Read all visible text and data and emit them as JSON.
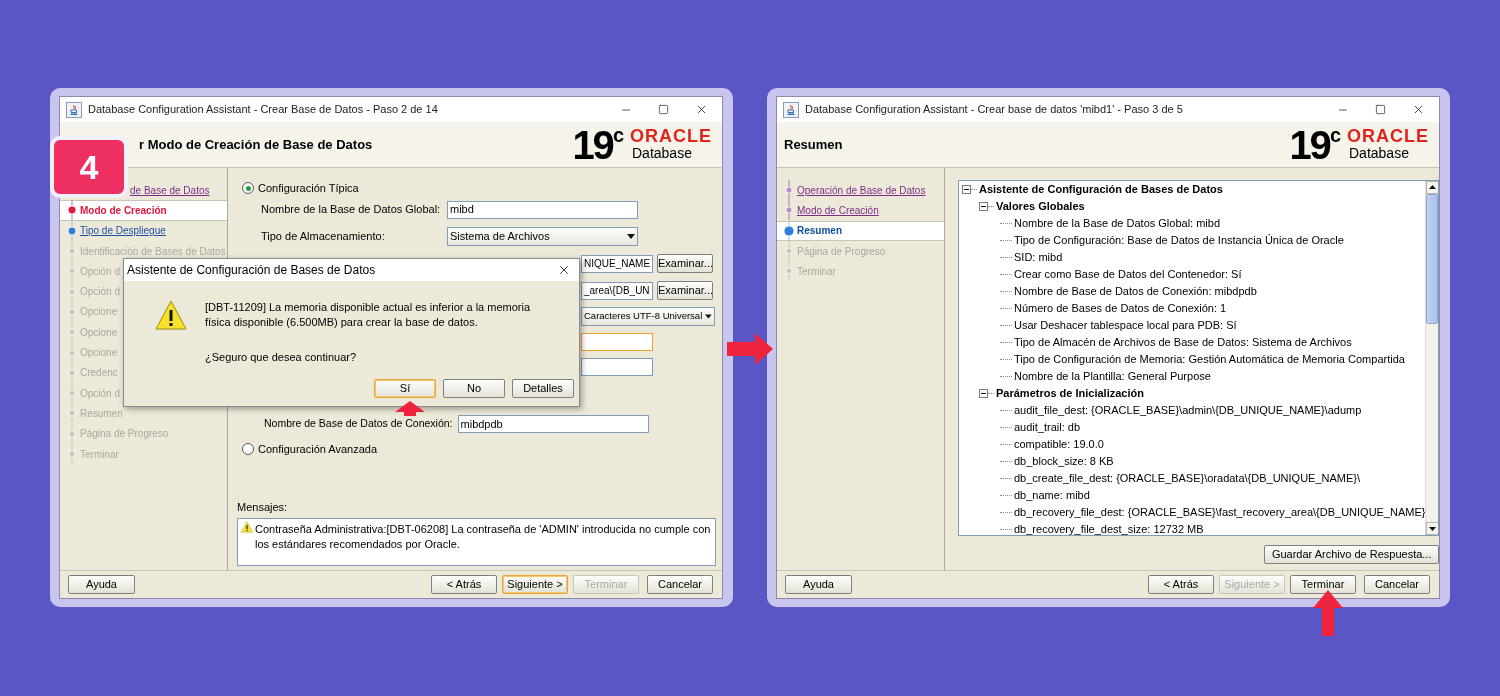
{
  "badge": {
    "label": "4"
  },
  "left_window": {
    "title": "Database Configuration Assistant - Crear Base de Datos - Paso 2 de 14",
    "header_title": "r Modo de Creación de Base de Datos",
    "logo": {
      "version": "19",
      "suffix": "c",
      "brand": "ORACLE",
      "product": "Database"
    },
    "steps": [
      {
        "label": "de Base de Datos",
        "kind": "visited"
      },
      {
        "label": "Modo de Creación",
        "kind": "error"
      },
      {
        "label": "Tipo de Despliegue",
        "kind": "available"
      },
      {
        "label": "Identificación de Bases de Datos",
        "kind": "pending"
      },
      {
        "label": "Opción d",
        "kind": "pending"
      },
      {
        "label": "Opción d",
        "kind": "pending"
      },
      {
        "label": "Opcione",
        "kind": "pending"
      },
      {
        "label": "Opcione",
        "kind": "pending"
      },
      {
        "label": "Opcione",
        "kind": "pending"
      },
      {
        "label": "Credenc",
        "kind": "pending"
      },
      {
        "label": "Opción d",
        "kind": "pending"
      },
      {
        "label": "Resumen",
        "kind": "pending"
      },
      {
        "label": "Página de Progreso",
        "kind": "pending"
      },
      {
        "label": "Terminar",
        "kind": "pending"
      }
    ],
    "typical_option": {
      "label": "Configuración Típica",
      "selected": true
    },
    "fields": [
      {
        "kind": "text",
        "label": "Nombre de la Base de Datos Global:",
        "value": "mibd",
        "focused": false
      },
      {
        "kind": "select",
        "label": "Tipo de Almacenamiento:",
        "value": "Sistema de Archivos",
        "focused": false
      },
      {
        "kind": "text",
        "value": "NIQUE_NAME",
        "button": "Examinar...",
        "focused": false
      },
      {
        "kind": "text",
        "value": "_area\\{DB_UN",
        "button": "Examinar...",
        "focused": false
      },
      {
        "kind": "select",
        "value": "Caracteres UTF-8 Universal",
        "focused": false
      },
      {
        "kind": "text",
        "focused": true
      },
      {
        "kind": "text",
        "focused": false
      },
      {
        "kind": "text",
        "label": "Nombre de Base de Datos de Conexión:",
        "value": "mibdpdb",
        "focused": false
      }
    ],
    "advanced_option": {
      "label": "Configuración Avanzada",
      "selected": false
    },
    "messages_label": "Mensajes:",
    "message": "Contraseña Administrativa:[DBT-06208] La contraseña de 'ADMIN' introducida no cumple con los estándares recomendados por Oracle.",
    "help_button": "Ayuda",
    "buttons": [
      {
        "label": "< Atrás",
        "disabled": false,
        "focused": false
      },
      {
        "label": "Siguiente >",
        "disabled": false,
        "focused": true
      },
      {
        "label": "Terminar",
        "disabled": true,
        "focused": false
      },
      {
        "label": "Cancelar",
        "disabled": false,
        "focused": false
      }
    ],
    "dialog": {
      "title": "Asistente de Configuración de Bases de Datos",
      "message": "[DBT-11209] La memoria disponible actual es inferior a la memoria física disponible (6.500MB) para crear la base de datos.",
      "question": "¿Seguro que desea continuar?",
      "buttons": [
        {
          "label": "Sí",
          "focused": true
        },
        {
          "label": "No",
          "focused": false
        },
        {
          "label": "Detalles",
          "focused": false
        }
      ]
    }
  },
  "right_window": {
    "title": "Database Configuration Assistant - Crear base de datos 'mibd1' - Paso 3 de 5",
    "header_title": "Resumen",
    "logo": {
      "version": "19",
      "suffix": "c",
      "brand": "ORACLE",
      "product": "Database"
    },
    "steps": [
      {
        "label": "Operación de Base de Datos",
        "kind": "visited"
      },
      {
        "label": "Modo de Creación",
        "kind": "visited"
      },
      {
        "label": "Resumen",
        "kind": "current"
      },
      {
        "label": "Página de Progreso",
        "kind": "pending"
      },
      {
        "label": "Terminar",
        "kind": "pending"
      }
    ],
    "tree": [
      {
        "label": "Asistente de Configuración de Bases de Datos",
        "expanded": true,
        "children": [
          {
            "label": "Valores Globales",
            "expanded": true,
            "children": [
              {
                "label": "Nombre de la Base de Datos Global: mibd"
              },
              {
                "label": "Tipo de Configuración: Base de Datos de Instancia Única de Oracle"
              },
              {
                "label": "SID: mibd"
              },
              {
                "label": "Crear como Base de Datos del Contenedor: Sí"
              },
              {
                "label": "Nombre de Base de Datos de Conexión: mibdpdb"
              },
              {
                "label": "Número de Bases de Datos de Conexión: 1"
              },
              {
                "label": "Usar Deshacer tablespace local para PDB: Sí"
              },
              {
                "label": "Tipo de Almacén de Archivos de Base de Datos: Sistema de Archivos"
              },
              {
                "label": "Tipo de Configuración de Memoria: Gestión Automática de Memoria Compartida"
              },
              {
                "label": "Nombre de la Plantilla: General Purpose"
              }
            ]
          },
          {
            "label": "Parámetros de Inicialización",
            "expanded": true,
            "children": [
              {
                "label": "audit_file_dest: {ORACLE_BASE}\\admin\\{DB_UNIQUE_NAME}\\adump"
              },
              {
                "label": "audit_trail: db"
              },
              {
                "label": "compatible: 19.0.0"
              },
              {
                "label": "db_block_size: 8 KB"
              },
              {
                "label": "db_create_file_dest: {ORACLE_BASE}\\oradata\\{DB_UNIQUE_NAME}\\"
              },
              {
                "label": "db_name: mibd"
              },
              {
                "label": "db_recovery_file_dest: {ORACLE_BASE}\\fast_recovery_area\\{DB_UNIQUE_NAME}"
              },
              {
                "label": "db_recovery_file_dest_size: 12732 MB"
              }
            ]
          }
        ]
      }
    ],
    "save_button": "Guardar Archivo de Respuesta...",
    "help_button": "Ayuda",
    "buttons": [
      {
        "label": "< Atrás",
        "disabled": false,
        "focused": false
      },
      {
        "label": "Siguiente >",
        "disabled": true,
        "focused": false
      },
      {
        "label": "Terminar",
        "disabled": false,
        "focused": false
      },
      {
        "label": "Cancelar",
        "disabled": false,
        "focused": false
      }
    ]
  }
}
